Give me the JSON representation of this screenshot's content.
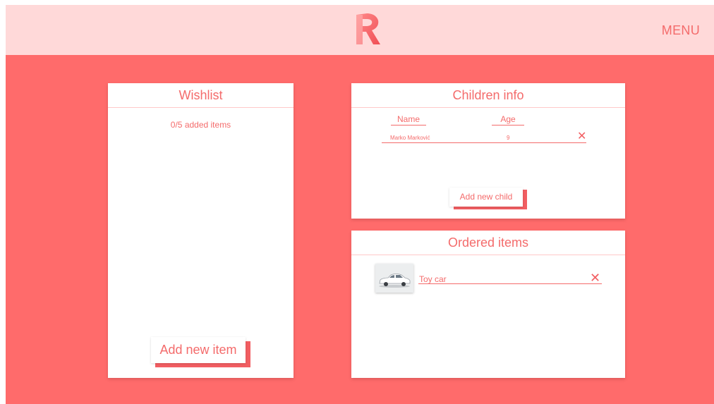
{
  "header": {
    "logo_icon": "r-logo-icon",
    "menu_label": "MENU"
  },
  "wishlist": {
    "title": "Wishlist",
    "count_text": "0/5 added items",
    "add_button": "Add new item"
  },
  "children": {
    "title": "Children info",
    "columns": [
      "Name",
      "Age"
    ],
    "rows": [
      {
        "name": "Marko Marković",
        "age": "9",
        "remove_icon": "close-icon"
      }
    ],
    "add_button": "Add new child"
  },
  "ordered": {
    "title": "Ordered items",
    "items": [
      {
        "name": "Toy car",
        "thumbnail_icon": "toy-car-image",
        "remove_icon": "close-icon"
      }
    ]
  },
  "colors": {
    "background": "#ff6b6b",
    "header": "#ffd9d9",
    "accent": "#f46b6b",
    "card": "#ffffff"
  },
  "icons": {
    "remove": "✕"
  }
}
